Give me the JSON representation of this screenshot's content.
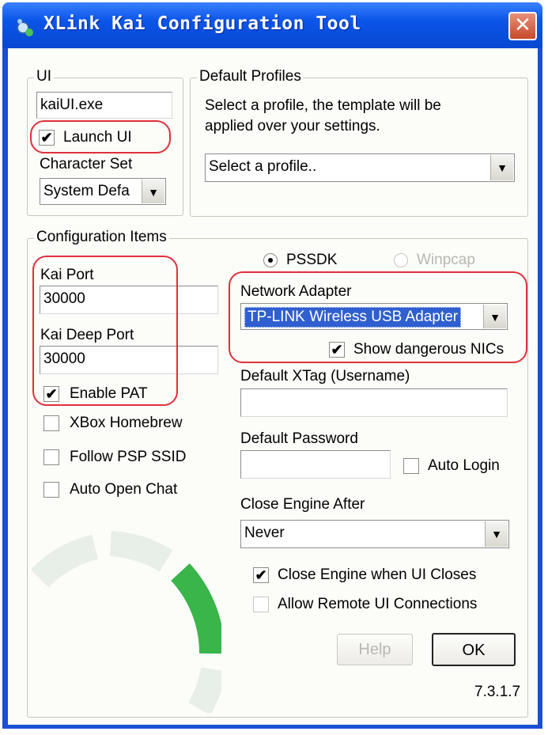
{
  "window": {
    "title": "XLink Kai Configuration Tool",
    "close_glyph": "✕",
    "accent": "#0a55e8"
  },
  "ui_group": {
    "legend": "UI",
    "exe_value": "kaiUI.exe",
    "launch_ui_label": "Launch UI",
    "launch_ui_checked": true,
    "charset_label": "Character Set",
    "charset_value": "System Defa"
  },
  "profiles_group": {
    "legend": "Default Profiles",
    "description_line1": "Select a profile, the template will be",
    "description_line2": "applied over your settings.",
    "profile_value": "Select a profile.."
  },
  "config_group": {
    "legend": "Configuration Items",
    "kai_port_label": "Kai Port",
    "kai_port_value": "30000",
    "kai_deep_port_label": "Kai Deep Port",
    "kai_deep_port_value": "30000",
    "enable_pat_label": "Enable PAT",
    "xbox_homebrew_label": "XBox Homebrew",
    "follow_psp_ssid_label": "Follow PSP SSID",
    "auto_open_chat_label": "Auto Open Chat",
    "pssdk_label": "PSSDK",
    "winpcap_label": "Winpcap",
    "network_adapter_label": "Network Adapter",
    "network_adapter_value": "TP-LINK Wireless USB Adapter",
    "show_dangerous_label": "Show dangerous NICs",
    "xtag_label": "Default XTag (Username)",
    "xtag_value": "",
    "password_label": "Default Password",
    "password_value": "",
    "auto_login_label": "Auto Login",
    "close_engine_label": "Close Engine After",
    "close_engine_value": "Never",
    "close_engine_ui_label": "Close Engine when UI Closes",
    "allow_remote_label": "Allow Remote UI Connections",
    "help_label": "Help",
    "ok_label": "OK",
    "version": "7.3.1.7"
  },
  "icons": {
    "dropdown_arrow": "▼",
    "check_mark": "✔"
  },
  "colors": {
    "highlight_annotation": "#e0303c",
    "logo_green": "#39b54a"
  }
}
